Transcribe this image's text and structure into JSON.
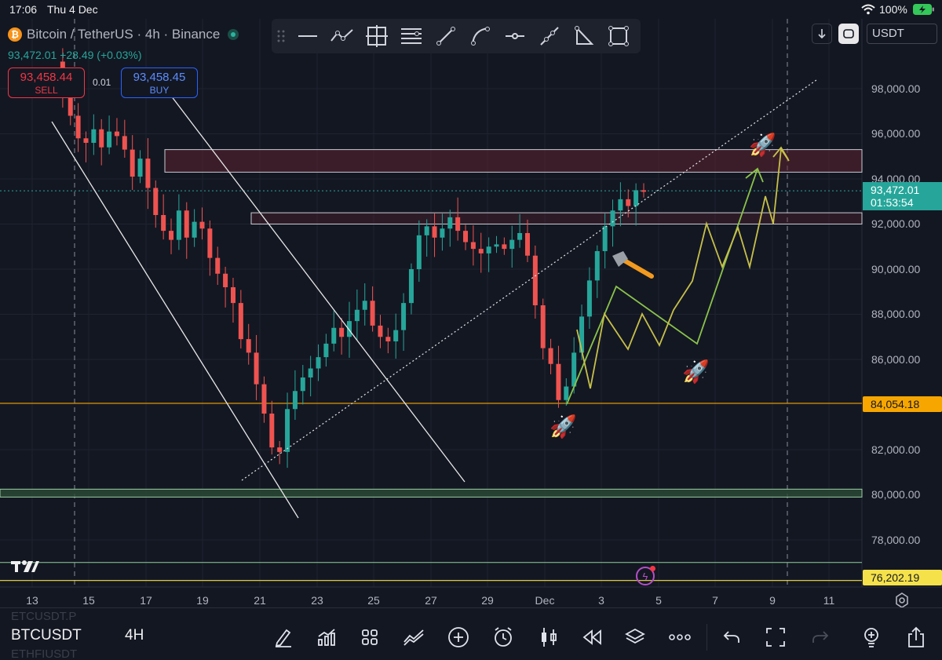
{
  "status_bar": {
    "time": "17:06",
    "date": "Thu 4 Dec",
    "battery": "100%"
  },
  "header": {
    "title": "Bitcoin / TetherUS · 4h · Binance",
    "last_price": "93,472.01",
    "change": "+28.49 (+0.03%)",
    "sell": {
      "price": "93,458.44",
      "label": "SELL"
    },
    "buy": {
      "price": "93,458.45",
      "label": "BUY"
    },
    "spread": "0.01",
    "currency": "USDT"
  },
  "drawing_toolbar": {
    "tools": [
      "line-tool-icon",
      "polyline-tool-icon",
      "crosshair-box-icon",
      "fib-retracement-icon",
      "trend-line-icon",
      "curve-icon",
      "horizontal-ray-icon",
      "path-icon",
      "triangle-icon",
      "rectangle-icon"
    ]
  },
  "price_axis": {
    "labels": [
      "98,000.00",
      "96,000.00",
      "94,000.00",
      "92,000.00",
      "90,000.00",
      "88,000.00",
      "86,000.00",
      "82,000.00",
      "80,000.00",
      "78,000.00"
    ],
    "current_price": "93,472.01",
    "countdown": "01:53:54",
    "support_level": "84,054.18",
    "bottom_level": "76,202.19"
  },
  "time_axis": {
    "labels": [
      "13",
      "15",
      "17",
      "19",
      "21",
      "23",
      "25",
      "27",
      "29",
      "Dec",
      "3",
      "5",
      "7",
      "9",
      "11"
    ]
  },
  "chart_data": {
    "type": "candlestick",
    "symbol": "Bitcoin / TetherUS",
    "interval": "4h",
    "exchange": "Binance",
    "x_ticks": [
      "13",
      "15",
      "17",
      "19",
      "21",
      "23",
      "25",
      "27",
      "29",
      "Dec",
      "3",
      "5",
      "7",
      "9",
      "11"
    ],
    "y_ticks": [
      98000,
      96000,
      94000,
      92000,
      90000,
      88000,
      86000,
      82000,
      80000,
      78000
    ],
    "ylim": [
      75800,
      99500
    ],
    "last_price": 93472.01,
    "closes": [
      99200,
      97800,
      96800,
      95800,
      95600,
      96200,
      95400,
      96100,
      95900,
      95300,
      94100,
      94900,
      93600,
      92400,
      91700,
      91300,
      92600,
      91400,
      92100,
      91800,
      90500,
      89800,
      89200,
      88500,
      86900,
      86300,
      84900,
      83600,
      82100,
      81900,
      83800,
      84600,
      85200,
      85600,
      86100,
      86700,
      87400,
      87000,
      87700,
      88200,
      88600,
      87500,
      87000,
      86800,
      87300,
      88500,
      90000,
      91500,
      91900,
      91400,
      91800,
      92300,
      91700,
      91200,
      90900,
      90700,
      91000,
      91100,
      90900,
      91300,
      91600,
      90600,
      88400,
      86500,
      85800,
      84200,
      84800,
      86300,
      87900,
      89500,
      90800,
      91900,
      92600,
      93100,
      92800,
      93500,
      93472
    ],
    "horizontal_levels": [
      94300,
      95300,
      92500,
      92000,
      84054.18,
      80200,
      79900,
      77000,
      76202.19
    ],
    "annotations": [
      "rocket",
      "rocket",
      "rocket",
      "hammer"
    ]
  },
  "bottom_toolbar": {
    "symbol": "BTCUSDT",
    "interval": "4H",
    "ghost_above": "ETCUSDT.P",
    "ghost_below": "ETHFIUSDT"
  },
  "colors": {
    "up": "#26a69a",
    "down": "#ef5350",
    "support": "#f7a600",
    "background": "#131722",
    "resistance_zone": "#5c2230",
    "projection_green": "#8bc34a",
    "projection_yellow": "#c7c04a"
  }
}
